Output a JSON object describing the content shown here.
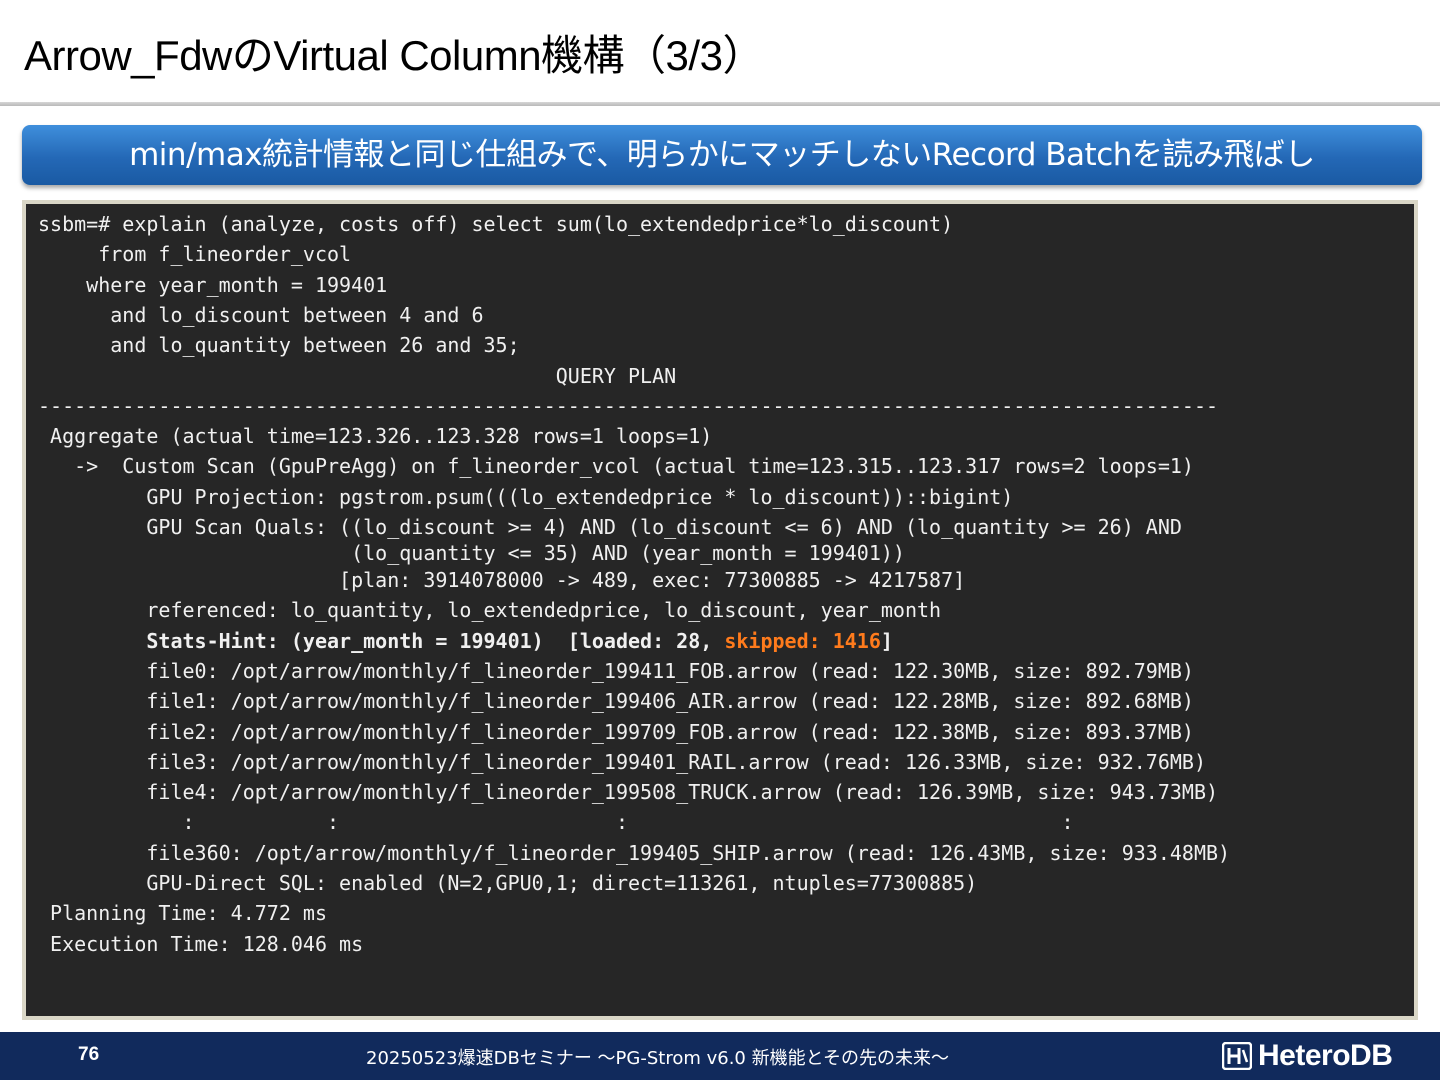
{
  "slide": {
    "title": "Arrow_FdwのVirtual Column機構（3/3）",
    "banner": "min/max統計情報と同じ仕組みで、明らかにマッチしないRecord Batchを読み飛ばし"
  },
  "terminal": {
    "lines": [
      "ssbm=# explain (analyze, costs off) select sum(lo_extendedprice*lo_discount)",
      "     from f_lineorder_vcol",
      "    where year_month = 199401",
      "      and lo_discount between 4 and 6",
      "      and lo_quantity between 26 and 35;",
      "                                           QUERY PLAN",
      "--------------------------------------------------------------------------------------------------",
      " Aggregate (actual time=123.326..123.328 rows=1 loops=1)",
      "   ->  Custom Scan (GpuPreAgg) on f_lineorder_vcol (actual time=123.315..123.317 rows=2 loops=1)",
      "         GPU Projection: pgstrom.psum(((lo_extendedprice * lo_discount))::bigint)",
      "         GPU Scan Quals: ((lo_discount >= 4) AND (lo_discount <= 6) AND (lo_quantity >= 26) AND",
      "                          (lo_quantity <= 35) AND (year_month = 199401))",
      "                         [plan: 3914078000 -> 489, exec: 77300885 -> 4217587]",
      "         referenced: lo_quantity, lo_extendedprice, lo_discount, year_month",
      "         Stats-Hint: (year_month = 199401)  [loaded: 28, ",
      "skipped: 1416",
      "]",
      "         file0: /opt/arrow/monthly/f_lineorder_199411_FOB.arrow (read: 122.30MB, size: 892.79MB)",
      "         file1: /opt/arrow/monthly/f_lineorder_199406_AIR.arrow (read: 122.28MB, size: 892.68MB)",
      "         file2: /opt/arrow/monthly/f_lineorder_199709_FOB.arrow (read: 122.38MB, size: 893.37MB)",
      "         file3: /opt/arrow/monthly/f_lineorder_199401_RAIL.arrow (read: 126.33MB, size: 932.76MB)",
      "         file4: /opt/arrow/monthly/f_lineorder_199508_TRUCK.arrow (read: 126.39MB, size: 943.73MB)",
      "            :           :                       :                                    :",
      "         file360: /opt/arrow/monthly/f_lineorder_199405_SHIP.arrow (read: 126.43MB, size: 933.48MB)",
      "         GPU-Direct SQL: enabled (N=2,GPU0,1; direct=113261, ntuples=77300885)",
      " Planning Time: 4.772 ms",
      " Execution Time: 128.046 ms"
    ]
  },
  "footer": {
    "page": "76",
    "text": "20250523爆速DBセミナー ～PG-Strom v6.0 新機能とその先の未来～",
    "logo": "HeteroDB"
  }
}
